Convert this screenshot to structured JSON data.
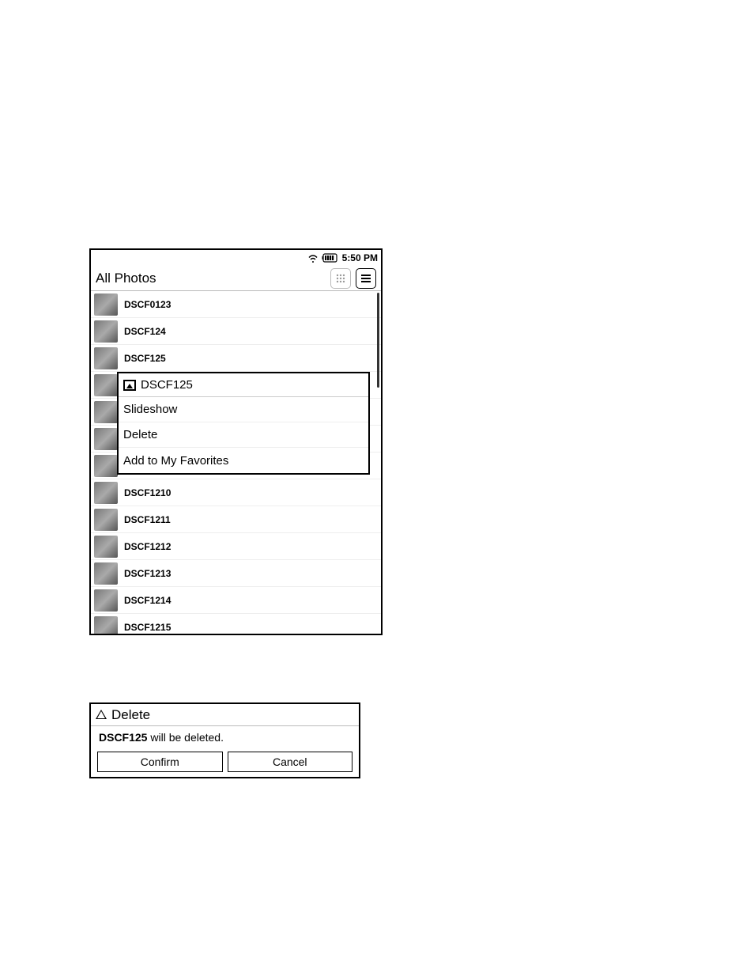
{
  "status_bar": {
    "time": "5:50 PM"
  },
  "header": {
    "title": "All Photos"
  },
  "photos": [
    {
      "name": "DSCF0123"
    },
    {
      "name": "DSCF124"
    },
    {
      "name": "DSCF125"
    },
    {
      "name": ""
    },
    {
      "name": ""
    },
    {
      "name": ""
    },
    {
      "name": ""
    },
    {
      "name": "DSCF1210"
    },
    {
      "name": "DSCF1211"
    },
    {
      "name": "DSCF1212"
    },
    {
      "name": "DSCF1213"
    },
    {
      "name": "DSCF1214"
    },
    {
      "name": "DSCF1215"
    }
  ],
  "context_menu": {
    "target": "DSCF125",
    "items": [
      "Slideshow",
      "Delete",
      "Add to My Favorites"
    ]
  },
  "dialog": {
    "title": "Delete",
    "filename": "DSCF125",
    "message_suffix": " will be deleted.",
    "confirm": "Confirm",
    "cancel": "Cancel"
  }
}
